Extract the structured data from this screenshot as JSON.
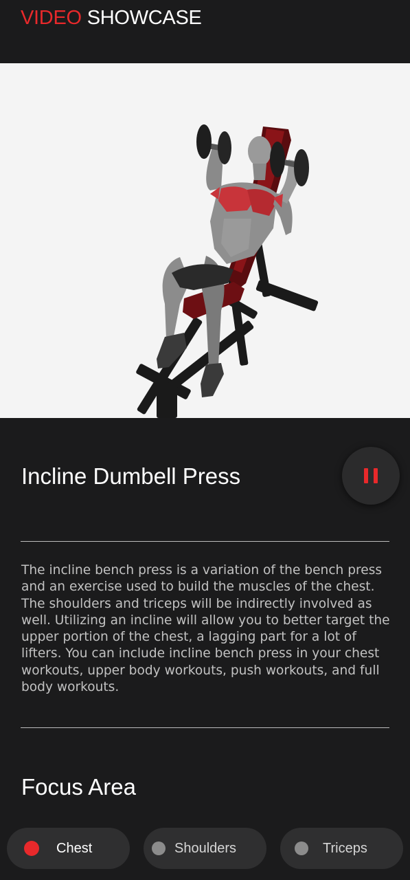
{
  "header": {
    "title_accent": "VIDEO",
    "title_rest": "SHOWCASE",
    "accent_color": "#e8292b"
  },
  "video": {
    "icon": "incline-dumbbell-press-illustration"
  },
  "exercise": {
    "name": "Incline Dumbell Press",
    "description": "The incline bench press is a variation of the bench press and an exercise used to build the muscles of the chest. The shoulders and triceps will be indirectly involved as well. Utilizing an incline will allow you to better target the upper portion of the chest, a lagging part for a lot of lifters. You can include incline bench press in your chest workouts, upper body workouts, push workouts, and full body workouts.",
    "control_icon": "pause-icon"
  },
  "focus": {
    "title": "Focus Area",
    "chips": [
      {
        "label": "Chest",
        "active": true
      },
      {
        "label": "Shoulders",
        "active": false
      },
      {
        "label": "Triceps",
        "active": false
      }
    ]
  },
  "colors": {
    "background": "#1b1b1c",
    "chip_background": "#2f2f30",
    "inactive_dot": "#8c8c8c",
    "active_dot": "#e8292b"
  }
}
